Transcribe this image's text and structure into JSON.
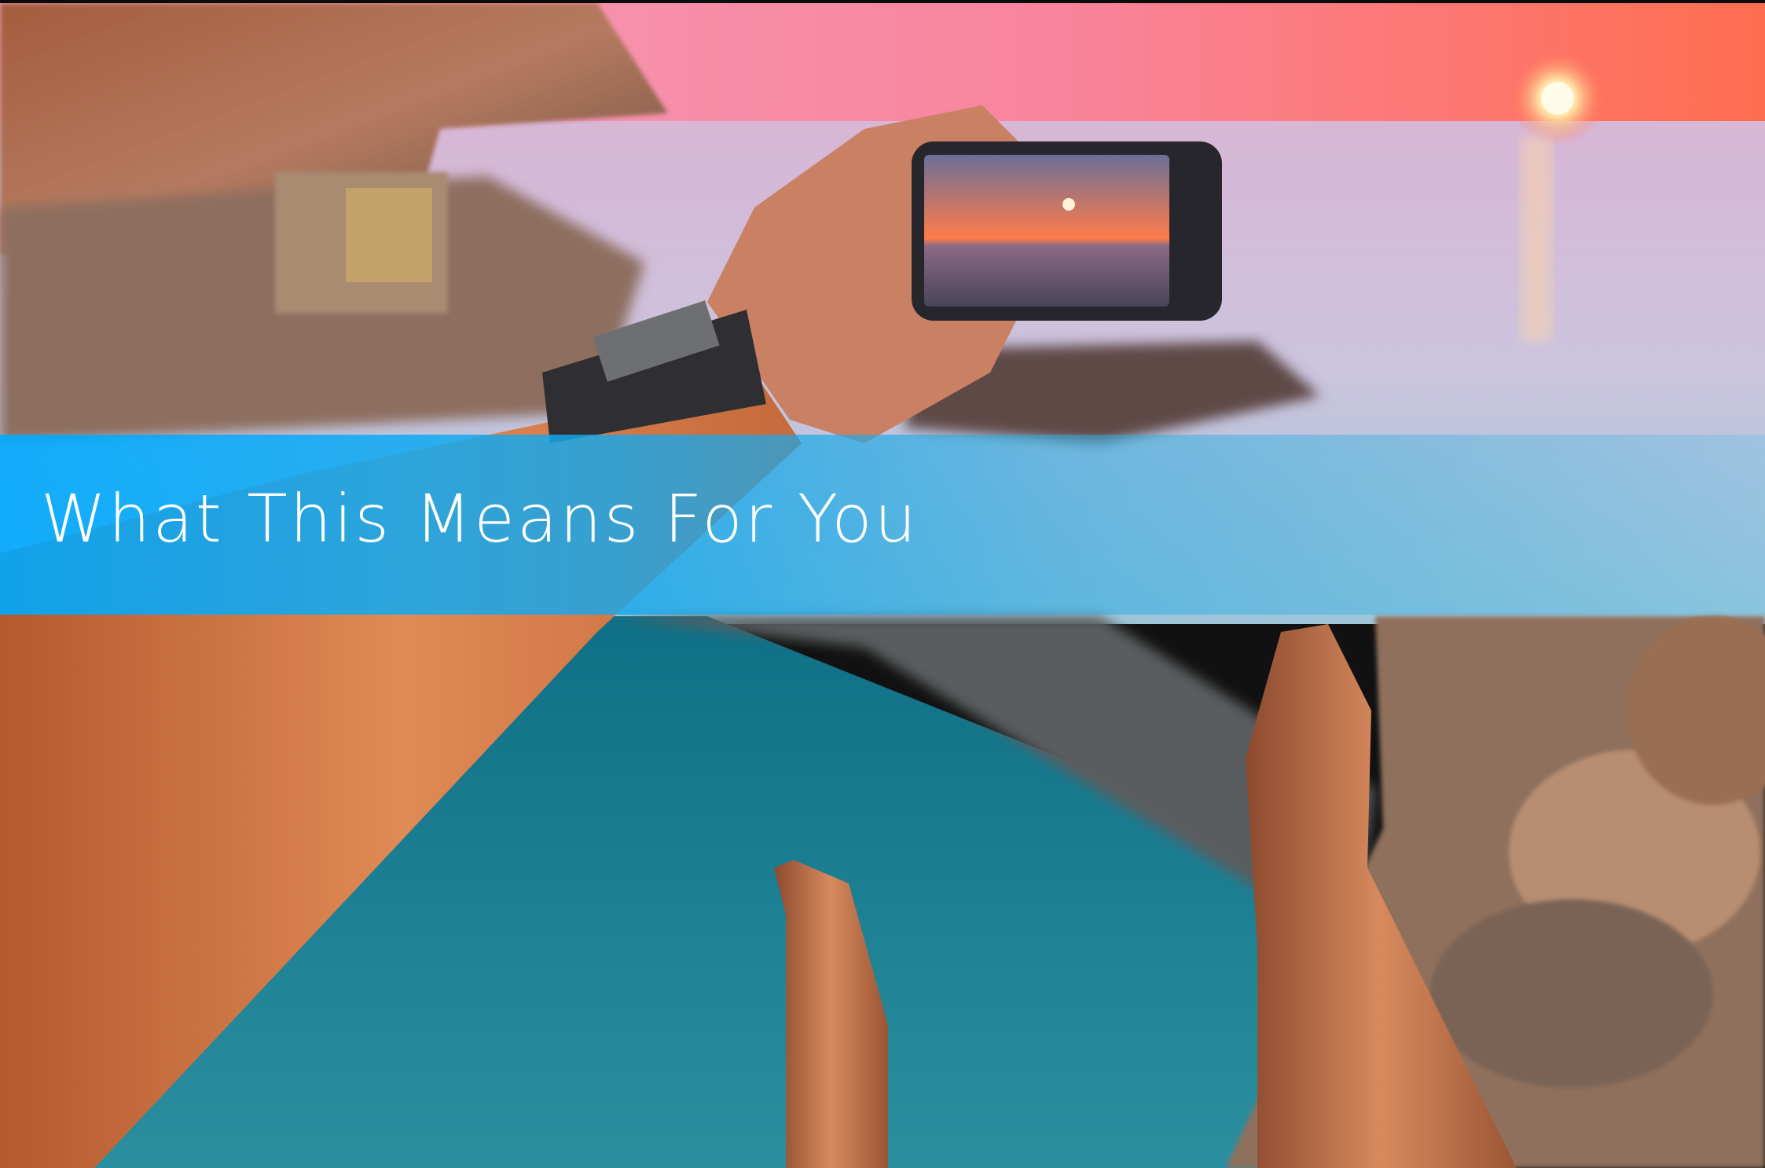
{
  "banner": {
    "title": "What This Means For You",
    "color": "#00AAFF"
  },
  "photo": {
    "palette": {
      "sky_top": "#f7a6c6",
      "sky_horizon": "#ff6a3c",
      "sun": "#fff6df",
      "sea": "#c8c7de",
      "rock": "#8a5b45",
      "pool": "#1b8a9c",
      "skin": "#d97c4a"
    }
  }
}
